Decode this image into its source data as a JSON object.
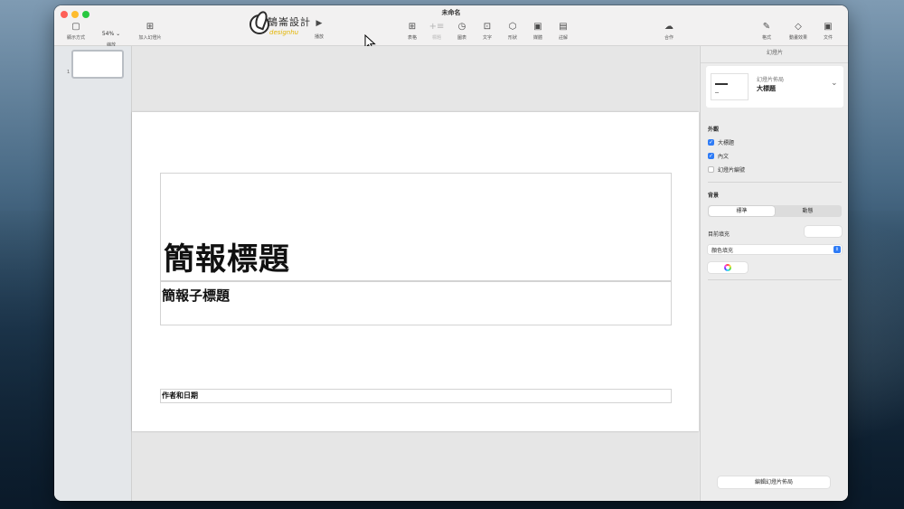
{
  "window": {
    "title": "未命名"
  },
  "toolbar": {
    "view_label": "顯示方式",
    "zoom_value": "54% ⌄",
    "zoom_label": "縮放",
    "add_slide_label": "加入幻燈片",
    "play_label": "播放",
    "table_label": "表格",
    "chart_dim_label": "標題",
    "chart_label": "圖表",
    "text_label": "文字",
    "shape_label": "形狀",
    "media_label": "媒體",
    "comment_label": "註解",
    "collab_label": "合作",
    "format_label": "格式",
    "animate_label": "動畫效果",
    "document_label": "文件",
    "icons": {
      "view": "▢",
      "add_slide": "⊞",
      "play": "▶",
      "table": "⊞",
      "chart_dim": "+≡",
      "chart": "◷",
      "text": "⊡",
      "shape": "⬡",
      "media": "▣",
      "comment": "▤",
      "collab": "☁",
      "format": "✎",
      "animate": "◇",
      "document": "▣"
    }
  },
  "logo": {
    "name": "鵠崙設計",
    "sub": "designhu"
  },
  "navigator": {
    "slides": [
      {
        "number": "1"
      }
    ]
  },
  "slide": {
    "title": "簡報標題",
    "subtitle": "簡報子標題",
    "author": "作者和日期"
  },
  "inspector": {
    "header": "幻燈片",
    "layout": {
      "label": "幻燈片佈局",
      "name": "大標題"
    },
    "appearance": {
      "title": "外觀",
      "items": [
        {
          "label": "大標題",
          "checked": true
        },
        {
          "label": "內文",
          "checked": true
        },
        {
          "label": "幻燈片編號",
          "checked": false
        }
      ]
    },
    "background": {
      "title": "背景",
      "tabs": [
        "標準",
        "動態"
      ],
      "current_fill_label": "目前填充",
      "fill_type": "顏色填充"
    },
    "edit_layout_button": "編輯幻燈片佈局"
  },
  "colors": {
    "accent": "#2f7cf6",
    "close": "#fe5f57",
    "minimize": "#febc2e",
    "maximize": "#28c840"
  }
}
